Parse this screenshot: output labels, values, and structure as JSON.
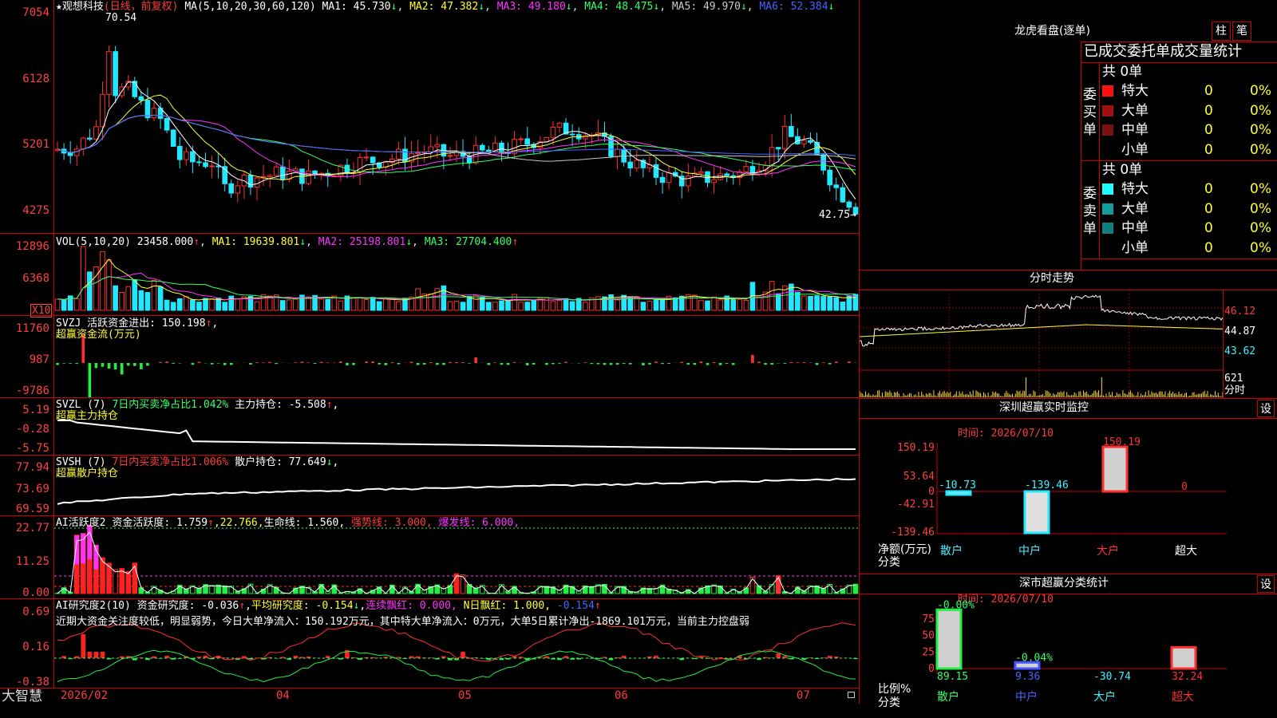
{
  "app": {
    "brand": "大智慧",
    "stock_name": "观想科技",
    "chart_mode": "(日线，前复权)",
    "star": "★"
  },
  "main": {
    "ma_label": "MA(5,10,20,30,60,120)",
    "ma": [
      {
        "label": "MA1: 45.730",
        "arrow": "↓",
        "color": "#ffffff"
      },
      {
        "label": "MA2: 47.382",
        "arrow": "↓",
        "color": "#ffff33"
      },
      {
        "label": "MA3: 49.180",
        "arrow": "↓",
        "color": "#ff33ff"
      },
      {
        "label": "MA4: 48.475",
        "arrow": "↓",
        "color": "#33ff66"
      },
      {
        "label": "MA5: 49.970",
        "arrow": "↓",
        "color": "#c8c8c8"
      },
      {
        "label": "MA6: 52.384",
        "arrow": "↓",
        "color": "#4466ff"
      }
    ],
    "high_note": "70.54",
    "low_note": "42.75",
    "y_ticks": [
      "7054",
      "6128",
      "5201",
      "4275"
    ]
  },
  "vol": {
    "label": "VOL(5,10,20)",
    "value": "23458.000",
    "value_arrow": "↑",
    "ma1": "MA1: 19639.801",
    "ma1_arrow": "↓",
    "ma2": "MA2: 25198.801",
    "ma2_arrow": "↓",
    "ma3": "MA3: 27704.400",
    "ma3_arrow": "↑",
    "y_ticks": [
      "12896",
      "6368"
    ],
    "unit": "X10"
  },
  "svzj": {
    "name": "SVZJ",
    "item": "活跃资金进出: 150.198",
    "arrow": "↑",
    "tail": ",",
    "subtitle": "超赢资金流(万元)",
    "y_ticks": [
      "11760",
      "987",
      "-9786"
    ]
  },
  "svzl": {
    "name": "SVZL (7)",
    "ratio": "7日内买卖净占比1.042%",
    "item": "主力持仓: -5.508",
    "arrow": "↑",
    "tail": ",",
    "subtitle": "超赢主力持仓",
    "y_ticks": [
      "5.19",
      "-0.28",
      "-5.75"
    ]
  },
  "svsh": {
    "name": "SVSH (7)",
    "ratio": "7日内买卖净占比1.006%",
    "item": "散户持仓: 77.649",
    "arrow": "↓",
    "tail": ",",
    "subtitle": "超赢散户持仓",
    "y_ticks": [
      "77.94",
      "73.69",
      "69.59"
    ]
  },
  "ai_active": {
    "name": "AI活跃度2",
    "item1": "资金活跃度: 1.759",
    "arrow1": "↑",
    "item2": ",22.766,",
    "item3": "生命线: 1.560,",
    "item4": "强势线: 3.000,",
    "item5": "爆发线: 6.000,",
    "y_ticks": [
      "22.77",
      "11.25",
      "0.00"
    ]
  },
  "ai_research": {
    "name": "AI研究度2(10)",
    "item1": "资金研究度: -0.036",
    "arrow1": "↑",
    "item2": ",",
    "item3": "平均研究度: -0.154",
    "arrow3": "↓",
    "item4": ",",
    "item5": "连续飘红: 0.000,",
    "item6": "N日飘红: 1.000,",
    "item7": "-0.154",
    "arrow7": "↑",
    "comment": "近期大资金关注度较低，明显弱势，今日大单净流入：150.192万元，其中特大单净流入：0万元，大单5日累计净出-1869.101万元，当前主力控盘弱",
    "y_ticks": [
      "0.69",
      "0.16",
      "-0.38"
    ]
  },
  "x_axis": [
    "2026/02",
    "04",
    "05",
    "06",
    "07"
  ],
  "dragon_tiger": {
    "title": "龙虎看盘(逐单)",
    "btn_bar": "柱",
    "btn_pen": "笔",
    "header": "已成交委托单成交量统计",
    "buy": {
      "side_label": "委买单",
      "total": "共 0单",
      "rows": [
        {
          "name": "特大",
          "count": "0",
          "pct": "0%",
          "color": "#ff1010"
        },
        {
          "name": "大单",
          "count": "0",
          "pct": "0%",
          "color": "#a01010"
        },
        {
          "name": "中单",
          "count": "0",
          "pct": "0%",
          "color": "#7a1010"
        },
        {
          "name": "小单",
          "count": "0",
          "pct": "0%",
          "color": "#000000"
        }
      ]
    },
    "sell": {
      "side_label": "委卖单",
      "total": "共 0单",
      "rows": [
        {
          "name": "特大",
          "count": "0",
          "pct": "0%",
          "color": "#22ffff"
        },
        {
          "name": "大单",
          "count": "0",
          "pct": "0%",
          "color": "#139c9c"
        },
        {
          "name": "中单",
          "count": "0",
          "pct": "0%",
          "color": "#0f7f7f"
        },
        {
          "name": "小单",
          "count": "0",
          "pct": "0%",
          "color": "#000000"
        }
      ]
    }
  },
  "intraday": {
    "title": "分时走势",
    "y_ticks": [
      "46.12",
      "44.87",
      "43.62"
    ],
    "vol_tick": "621",
    "vol_unit": "分时"
  },
  "sz_monitor": {
    "title": "深圳超赢实时监控",
    "btn": "设",
    "date": "时间: 2026/07/10",
    "y_ticks": [
      "150.19",
      "53.64",
      "0",
      "-42.91",
      "-139.46"
    ],
    "ylabel": "净额(万元)",
    "xlabel": "分类",
    "categories": [
      "散户",
      "中户",
      "大户",
      "超大"
    ],
    "values": [
      -10.73,
      -139.46,
      150.19,
      0
    ],
    "value_labels": [
      "-10.73",
      "-139.46",
      "150.19",
      "0"
    ]
  },
  "sz_class": {
    "title": "深市超赢分类统计",
    "btn": "设",
    "date": "时间: 2026/07/10",
    "y_ticks": [
      "75",
      "50",
      "25",
      "0"
    ],
    "ylabel": "比例%",
    "xlabel": "分类",
    "categories": [
      "散户",
      "中户",
      "大户",
      "超大"
    ],
    "top_labels": [
      "-0.00%",
      "-0.04%",
      "",
      ""
    ],
    "bottom_labels": [
      "89.15",
      "9.36",
      "-30.74",
      "32.24"
    ]
  }
}
